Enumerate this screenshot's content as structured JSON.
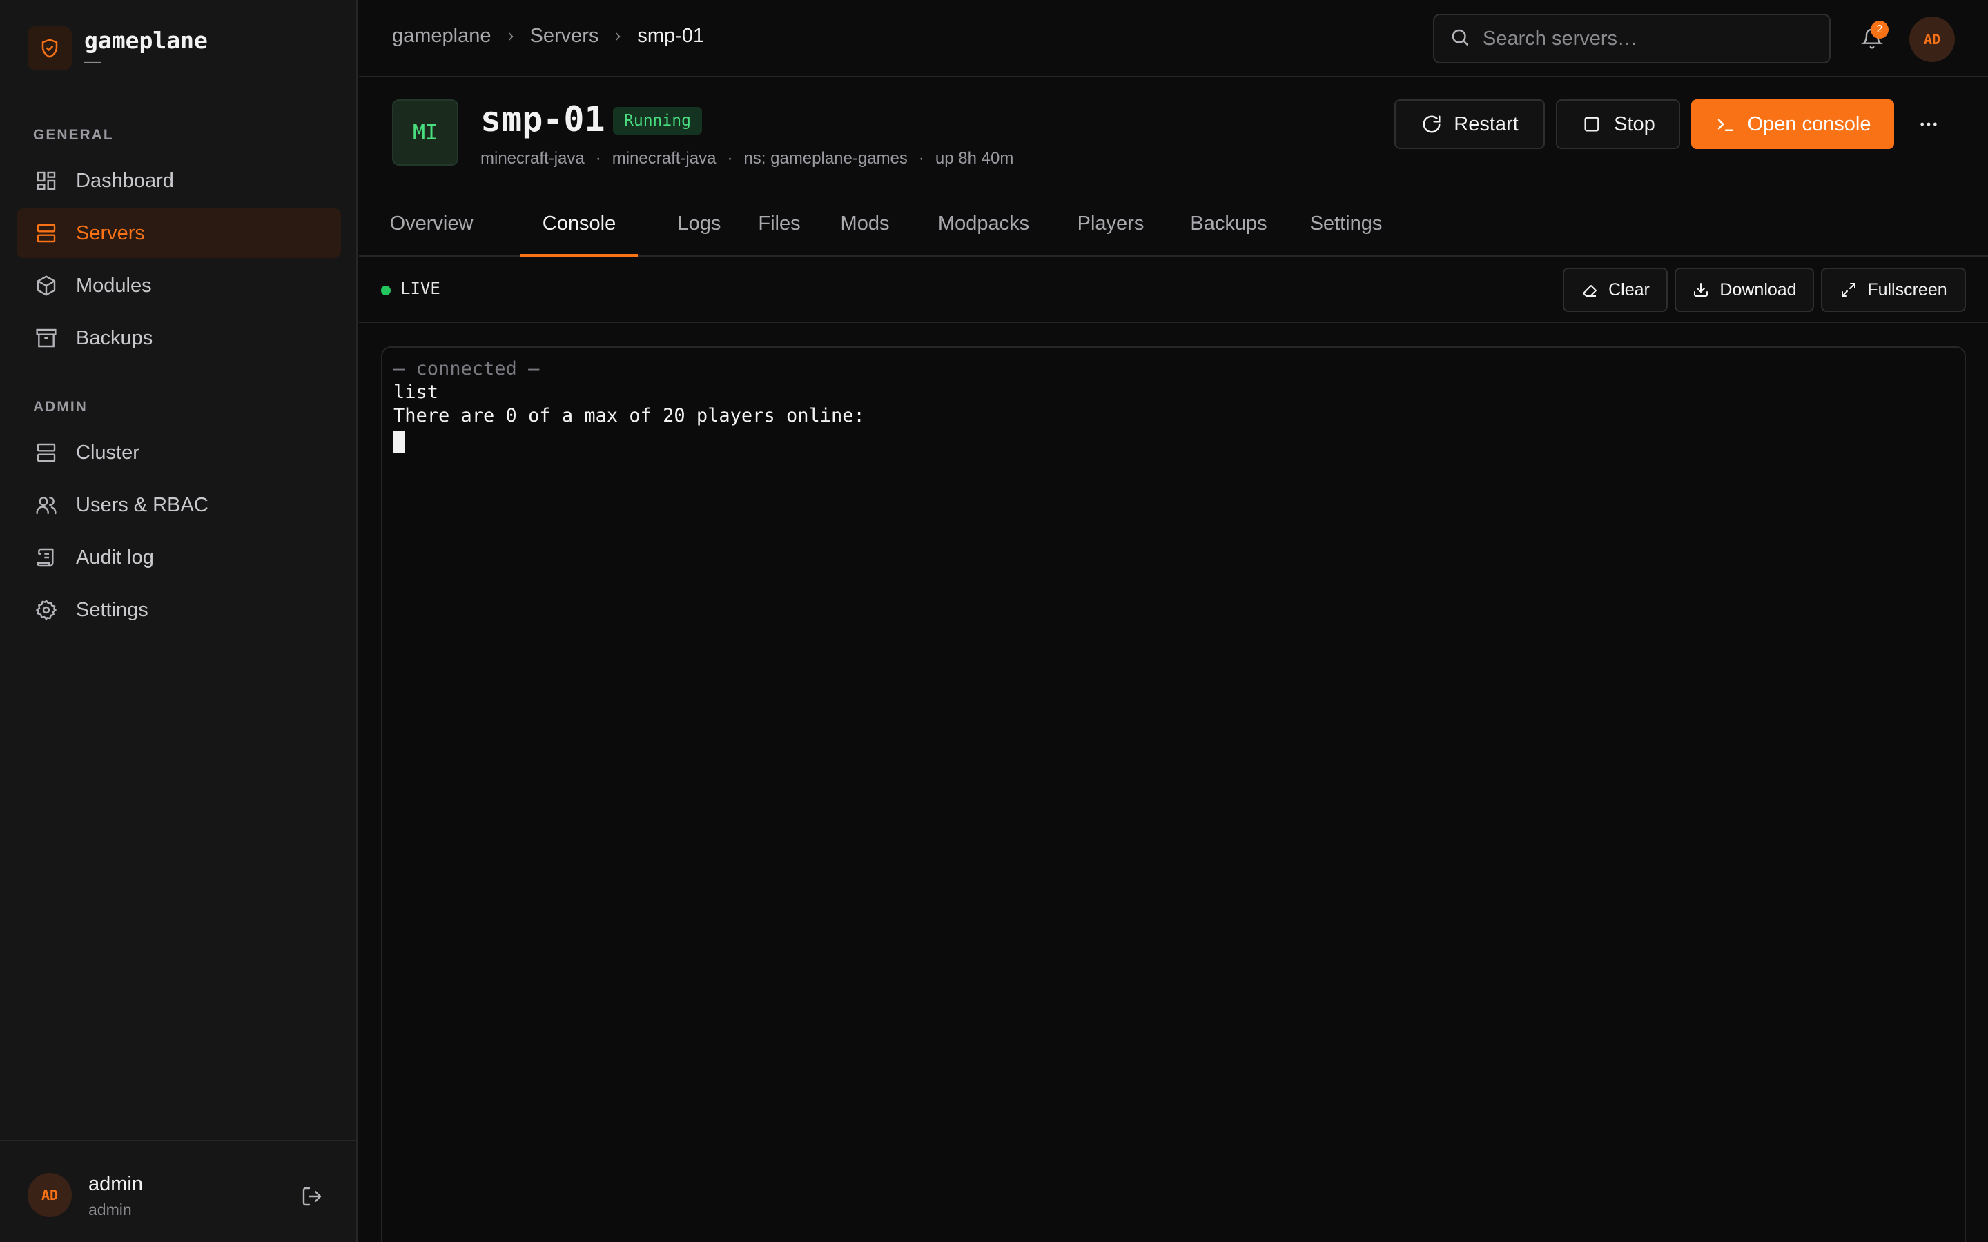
{
  "brand": {
    "name": "gameplane",
    "subtitle": "—"
  },
  "sidebar": {
    "sections": [
      {
        "title": "GENERAL",
        "items": [
          {
            "label": "Dashboard",
            "icon": "dashboard-icon"
          },
          {
            "label": "Servers",
            "icon": "server-icon",
            "active": true
          },
          {
            "label": "Modules",
            "icon": "package-icon"
          },
          {
            "label": "Backups",
            "icon": "archive-icon"
          }
        ]
      },
      {
        "title": "ADMIN",
        "items": [
          {
            "label": "Cluster",
            "icon": "server-icon"
          },
          {
            "label": "Users & RBAC",
            "icon": "users-icon"
          },
          {
            "label": "Audit log",
            "icon": "scroll-icon"
          },
          {
            "label": "Settings",
            "icon": "gear-icon"
          }
        ]
      }
    ],
    "user": {
      "initials": "AD",
      "name": "admin",
      "role": "admin"
    }
  },
  "topbar": {
    "breadcrumb": [
      "gameplane",
      "Servers",
      "smp-01"
    ],
    "search_placeholder": "Search servers…",
    "notification_count": "2",
    "avatar_initials": "AD"
  },
  "server": {
    "icon_text": "MI",
    "name": "smp-01",
    "status": "Running",
    "meta": [
      "minecraft-java",
      "minecraft-java",
      "ns: gameplane-games",
      "up 8h 40m"
    ],
    "actions": {
      "restart": "Restart",
      "stop": "Stop",
      "open_console": "Open console"
    }
  },
  "tabs": [
    "Overview",
    "Console",
    "Logs",
    "Files",
    "Mods",
    "Modpacks",
    "Players",
    "Backups",
    "Settings"
  ],
  "active_tab": "Console",
  "console": {
    "live_label": "LIVE",
    "buttons": {
      "clear": "Clear",
      "download": "Download",
      "fullscreen": "Fullscreen"
    },
    "lines": [
      {
        "text": "— connected —",
        "muted": true
      },
      {
        "text": "list",
        "muted": false
      },
      {
        "text": "There are 0 of a max of 20 players online:",
        "muted": false
      }
    ]
  },
  "colors": {
    "accent": "#f97316",
    "running": "#4ade80",
    "live": "#22c55e",
    "background": "#0c0c0d",
    "sidebar": "#161617"
  }
}
